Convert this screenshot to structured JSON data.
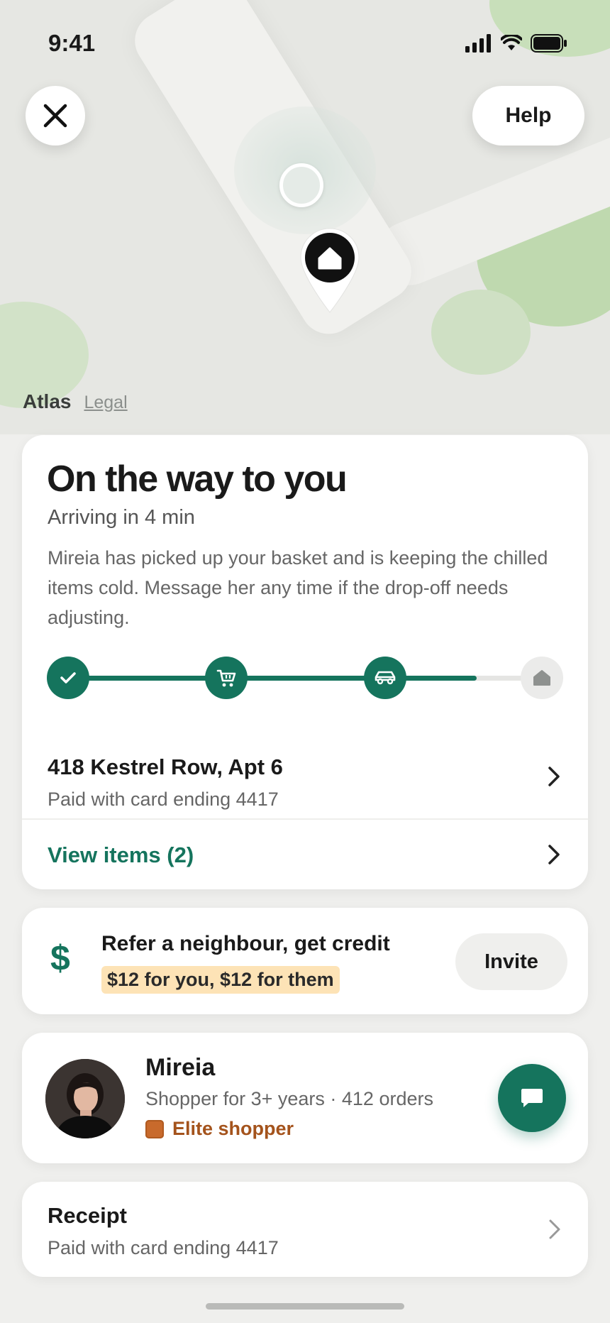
{
  "status_bar": {
    "time": "9:41"
  },
  "map": {
    "attribution": "Atlas",
    "legal": "Legal",
    "help_label": "Help",
    "close_icon": "close-icon",
    "pin_icon": "home-icon"
  },
  "order": {
    "title": "On the way to you",
    "eta": "Arriving in 4 min",
    "description": "Mireia has picked up your basket and is keeping the chilled items cold. Message her any time if the drop-off needs adjusting.",
    "progress": {
      "steps": [
        "confirmed",
        "shopping",
        "driving",
        "delivered"
      ],
      "current_step": 3,
      "fraction_complete": 0.86
    },
    "address": "418 Kestrel Row, Apt 6",
    "payment": "Paid with card ending 4417",
    "view_items": "View items (2)"
  },
  "referral": {
    "title": "Refer a neighbour, get credit",
    "offer": "$12 for you, $12 for them",
    "invite_label": "Invite",
    "icon": "$"
  },
  "shopper": {
    "name": "Mireia",
    "meta": "Shopper for 3+ years · 412 orders",
    "badge": "Elite shopper"
  },
  "receipt": {
    "title": "Receipt",
    "payment": "Paid with card ending 4417"
  },
  "colors": {
    "accent": "#15745d",
    "elite": "#a4531c",
    "highlight": "#fde3b6"
  }
}
